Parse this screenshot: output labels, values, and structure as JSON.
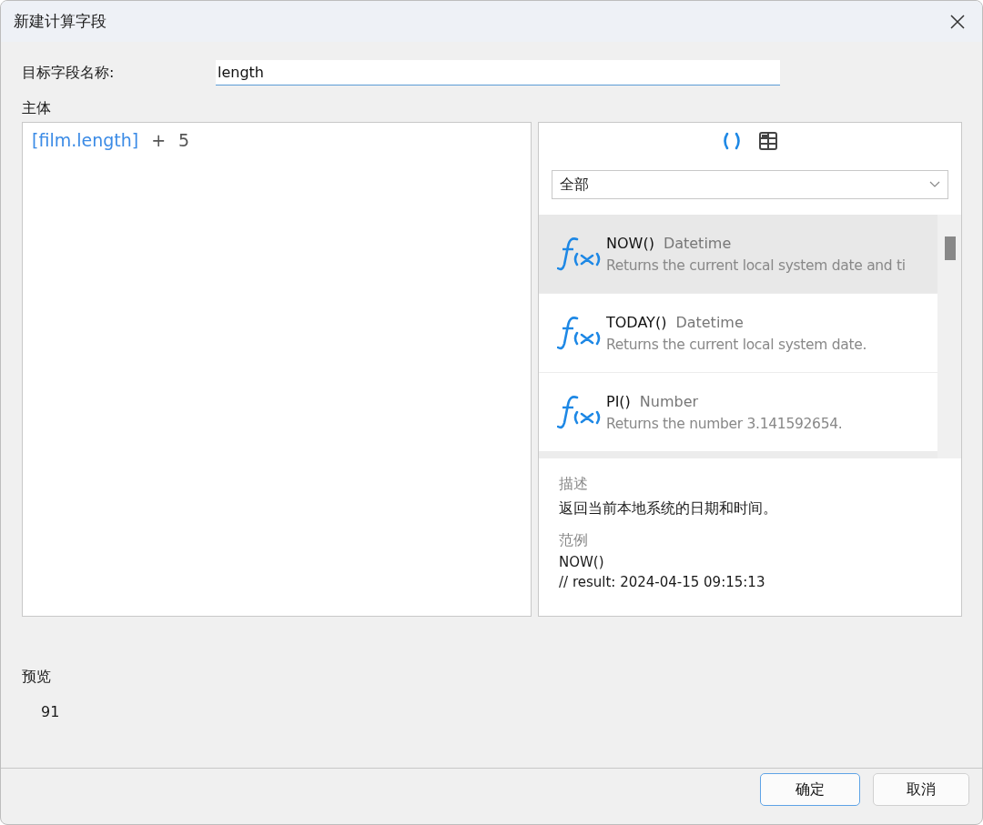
{
  "window": {
    "title": "新建计算字段"
  },
  "target_field": {
    "label": "目标字段名称:",
    "value": "length"
  },
  "body": {
    "label": "主体",
    "tokens": [
      {
        "kind": "field",
        "text": "[film.length]"
      },
      {
        "kind": "operator",
        "text": "+"
      },
      {
        "kind": "number",
        "text": "5"
      }
    ]
  },
  "function_panel": {
    "tabs": [
      {
        "kind": "functions",
        "selected": true
      },
      {
        "kind": "fields",
        "selected": false
      }
    ],
    "category": {
      "value": "全部"
    },
    "functions": [
      {
        "name": "NOW()",
        "category": "Datetime",
        "description": "Returns the current local system date and ti",
        "selected": true
      },
      {
        "name": "TODAY()",
        "category": "Datetime",
        "description": "Returns the current local system date.",
        "selected": false
      },
      {
        "name": "PI()",
        "category": "Number",
        "description": "Returns the number 3.141592654.",
        "selected": false
      }
    ],
    "details": {
      "description_label": "描述",
      "description": "返回当前本地系统的日期和时间。",
      "example_label": "范例",
      "example_lines": [
        "NOW()",
        "// result: 2024-04-15 09:15:13"
      ]
    }
  },
  "preview": {
    "label": "预览",
    "value": "91"
  },
  "buttons": [
    {
      "label": "确定",
      "kind": "primary"
    },
    {
      "label": "取消",
      "kind": "secondary"
    }
  ]
}
